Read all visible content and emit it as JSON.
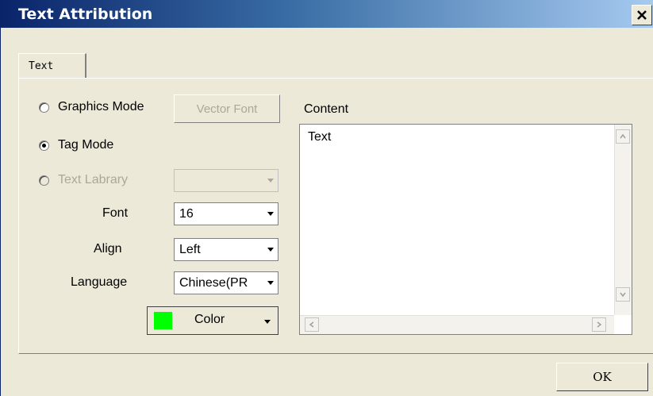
{
  "window": {
    "title": "Text Attribution",
    "close_icon": "close-icon"
  },
  "tabs": [
    {
      "label": "Text"
    }
  ],
  "modes": [
    {
      "label": "Graphics Mode",
      "checked": false,
      "enabled": true
    },
    {
      "label": "Tag Mode",
      "checked": true,
      "enabled": true
    },
    {
      "label": "Text Labrary",
      "checked": false,
      "enabled": false
    }
  ],
  "vector_font_button": {
    "label": "Vector Font",
    "enabled": false
  },
  "text_library_select": {
    "value": "",
    "enabled": false
  },
  "fields": {
    "font": {
      "label": "Font",
      "value": "16"
    },
    "align": {
      "label": "Align",
      "value": "Left"
    },
    "language": {
      "label": "Language",
      "value": "Chinese(PR"
    }
  },
  "color_button": {
    "label": "Color",
    "swatch": "#00ff00"
  },
  "content": {
    "label": "Content",
    "text": "Text"
  },
  "ok_button": {
    "label": "OK"
  },
  "colors": {
    "title_start": "#0a246a",
    "title_end": "#a6caf0",
    "dialog_bg": "#ece9d8"
  }
}
